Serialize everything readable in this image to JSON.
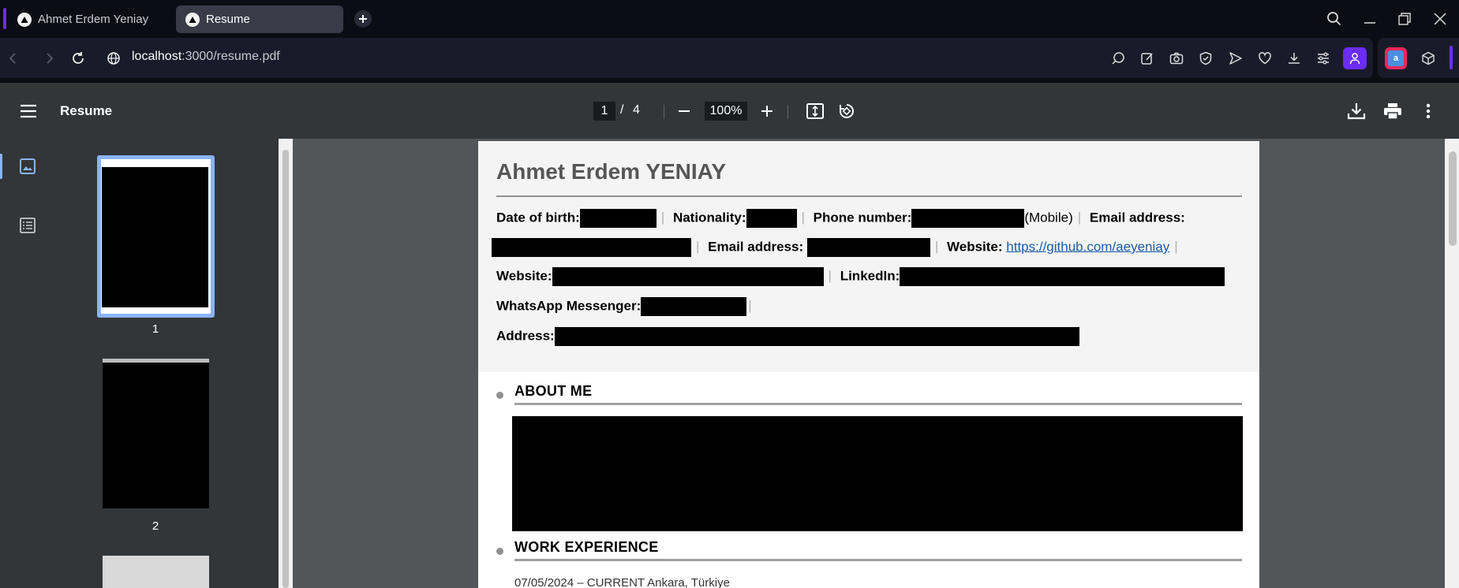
{
  "browser": {
    "tabs": [
      {
        "label": "Ahmet Erdem Yeniay",
        "active": false
      },
      {
        "label": "Resume",
        "active": true
      }
    ],
    "url_host": "localhost",
    "url_path": ":3000/resume.pdf",
    "accent_color": "#6b2cf5"
  },
  "viewer": {
    "title": "Resume",
    "current_page": "1",
    "page_separator": "/",
    "total_pages": "4",
    "zoom": "100%"
  },
  "thumbnails": [
    {
      "number": "1",
      "selected": true
    },
    {
      "number": "2",
      "selected": false
    }
  ],
  "document": {
    "name": "Ahmet Erdem YENIAY",
    "labels": {
      "dob": "Date of birth:",
      "nationality": "Nationality:",
      "phone": "Phone number:",
      "phone_type": "(Mobile)",
      "email1": "Email address:",
      "email2": "Email address:",
      "website1": "Website:",
      "website1_value": "https://github.com/aeyeniay",
      "website2": "Website:",
      "linkedin": "LinkedIn:",
      "whatsapp": "WhatsApp Messenger:",
      "address": "Address:"
    },
    "sections": {
      "about": "ABOUT ME",
      "work": "WORK EXPERIENCE"
    },
    "work_first_line": "07/05/2024 – CURRENT Ankara, Türkiye"
  }
}
